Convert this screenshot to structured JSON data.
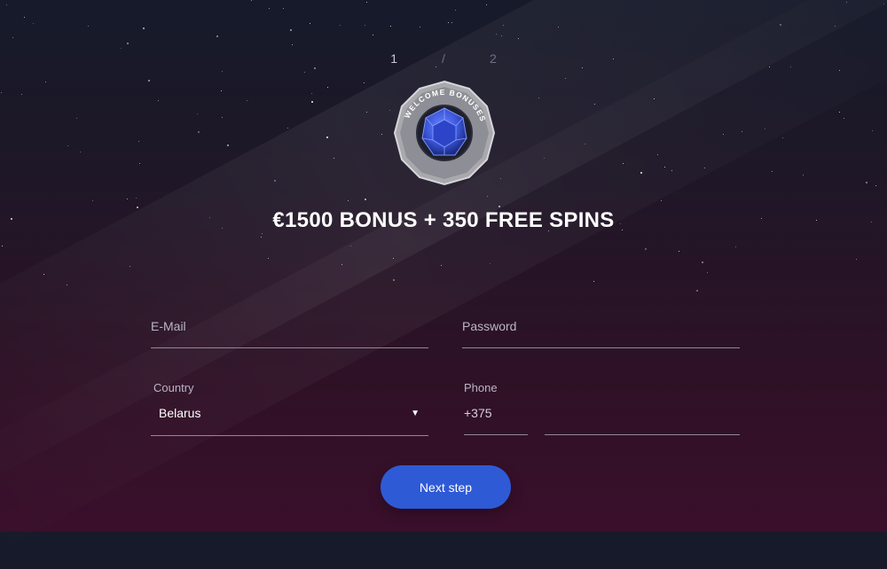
{
  "stepper": {
    "current": "1",
    "separator": "/",
    "total": "2"
  },
  "badge": {
    "ring_text": "WELCOME BONUSES"
  },
  "headline": "€1500 BONUS + 350 FREE SPINS",
  "form": {
    "email": {
      "label": "E-Mail",
      "value": ""
    },
    "password": {
      "label": "Password",
      "value": ""
    },
    "country": {
      "label": "Country",
      "value": "Belarus"
    },
    "phone": {
      "label": "Phone",
      "code": "+375",
      "number": ""
    }
  },
  "next_button": "Next step",
  "colors": {
    "accent": "#2f5ad6",
    "gem": "#3b57d9"
  },
  "icons": {
    "dropdown": "caret-down-icon",
    "badge": "gem-icon"
  }
}
